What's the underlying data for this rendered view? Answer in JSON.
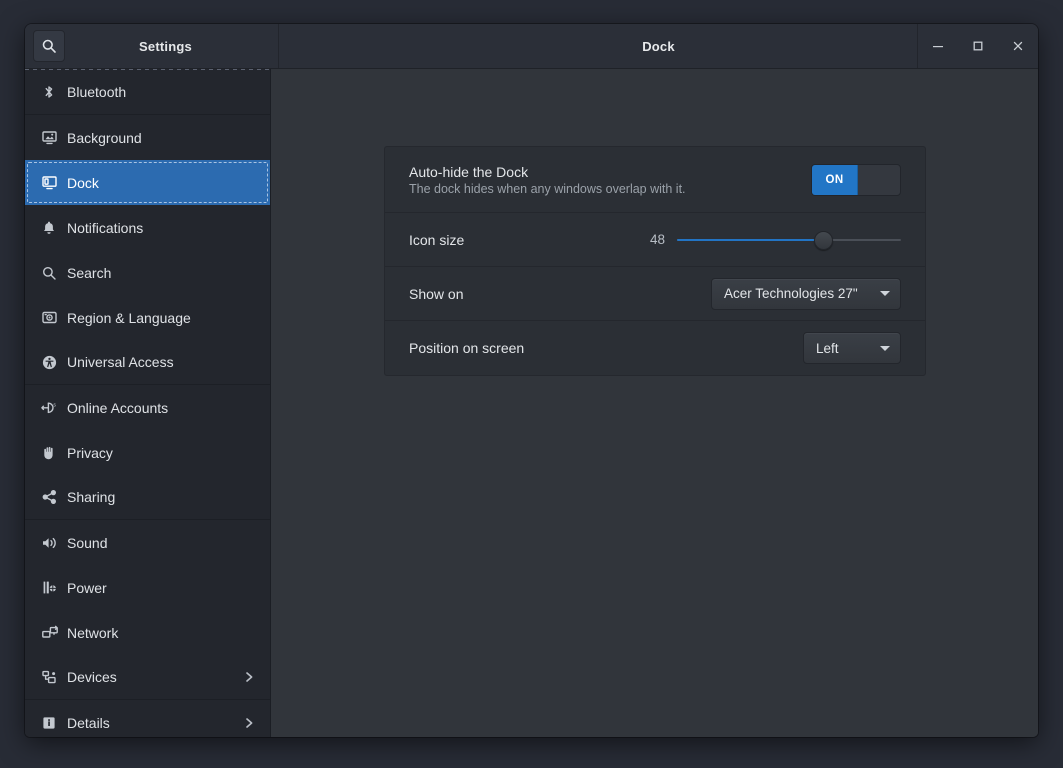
{
  "window": {
    "title": "Dock",
    "sidebar_title": "Settings",
    "controls": {
      "minimize": "–",
      "maximize": "□",
      "close": "×"
    }
  },
  "search": {
    "icon": "search-icon",
    "tooltip": "Search"
  },
  "sidebar": {
    "items": [
      {
        "label": "Bluetooth",
        "icon": "bluetooth-icon",
        "selected": false,
        "chevron": false,
        "sep_after": true
      },
      {
        "label": "Background",
        "icon": "background-icon",
        "selected": false,
        "chevron": false,
        "sep_after": false
      },
      {
        "label": "Dock",
        "icon": "dock-icon",
        "selected": true,
        "chevron": false,
        "sep_after": false
      },
      {
        "label": "Notifications",
        "icon": "bell-icon",
        "selected": false,
        "chevron": false,
        "sep_after": false
      },
      {
        "label": "Search",
        "icon": "magnifier-icon",
        "selected": false,
        "chevron": false,
        "sep_after": false
      },
      {
        "label": "Region & Language",
        "icon": "region-language-icon",
        "selected": false,
        "chevron": false,
        "sep_after": false
      },
      {
        "label": "Universal Access",
        "icon": "accessibility-icon",
        "selected": false,
        "chevron": false,
        "sep_after": true
      },
      {
        "label": "Online Accounts",
        "icon": "online-accounts-icon",
        "selected": false,
        "chevron": false,
        "sep_after": false
      },
      {
        "label": "Privacy",
        "icon": "hand-icon",
        "selected": false,
        "chevron": false,
        "sep_after": false
      },
      {
        "label": "Sharing",
        "icon": "share-icon",
        "selected": false,
        "chevron": false,
        "sep_after": true
      },
      {
        "label": "Sound",
        "icon": "speaker-icon",
        "selected": false,
        "chevron": false,
        "sep_after": false
      },
      {
        "label": "Power",
        "icon": "power-plug-icon",
        "selected": false,
        "chevron": false,
        "sep_after": false
      },
      {
        "label": "Network",
        "icon": "network-icon",
        "selected": false,
        "chevron": false,
        "sep_after": false
      },
      {
        "label": "Devices",
        "icon": "devices-icon",
        "selected": false,
        "chevron": true,
        "sep_after": true
      },
      {
        "label": "Details",
        "icon": "info-icon",
        "selected": false,
        "chevron": true,
        "sep_after": false
      }
    ]
  },
  "main": {
    "autohide": {
      "label": "Auto-hide the Dock",
      "description": "The dock hides when any windows overlap with it.",
      "toggle_state": "ON",
      "toggle_on": true
    },
    "icon_size": {
      "label": "Icon size",
      "value": "48",
      "min": 16,
      "max": 64,
      "percent": 65
    },
    "show_on": {
      "label": "Show on",
      "value": "Acer Technologies 27\""
    },
    "position": {
      "label": "Position on screen",
      "value": "Left"
    }
  },
  "colors": {
    "accent": "#2276c6",
    "selection": "#2c6bb0",
    "window_bg": "#2f3338",
    "sidebar_bg": "#23262d",
    "content_bg": "#31353b",
    "card_bg": "#2b2f35"
  }
}
